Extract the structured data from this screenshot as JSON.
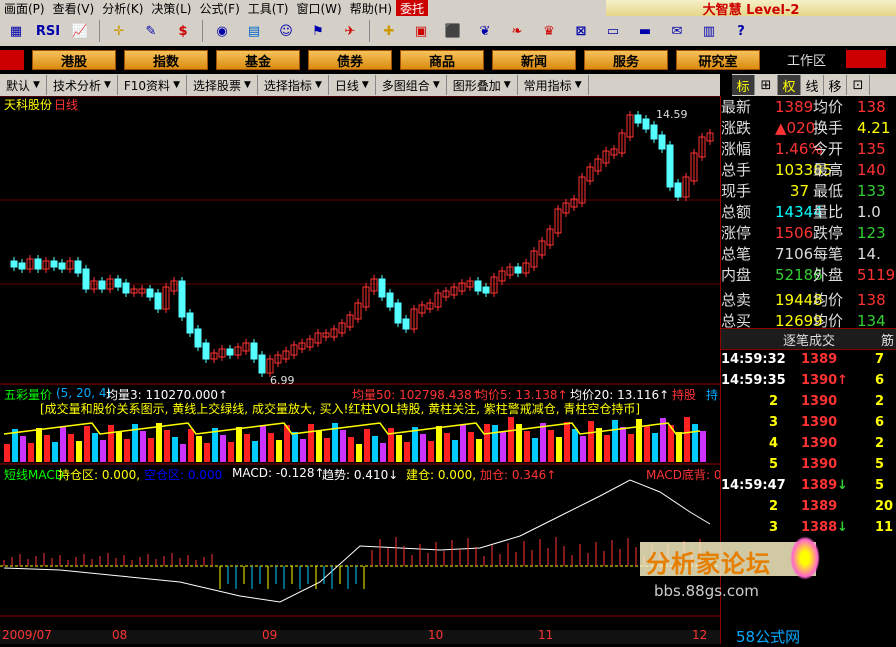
{
  "menu": [
    "画面(P)",
    "查看(V)",
    "分析(K)",
    "决策(L)",
    "公式(F)",
    "工具(T)",
    "窗口(W)",
    "帮助(H)",
    "委托"
  ],
  "brand": "大智慧 Level-2",
  "toolbar_icons": [
    "grid-icon",
    "rsi-icon",
    "chart-icon",
    "crosshair-icon",
    "ruler-icon",
    "dollar-icon",
    "stocks-icon",
    "f10-icon",
    "users-icon",
    "bell-icon",
    "alarm-icon",
    "fund-icon",
    "box-icon",
    "money-icon",
    "link-icon",
    "fire-icon",
    "chess-icon",
    "net-icon",
    "window-icon",
    "window2-icon",
    "mail-icon",
    "document-icon",
    "help-icon"
  ],
  "toolbar_labels": {
    "rsi": "RSI",
    "dollar": "$"
  },
  "nav": {
    "buttons": [
      "港股",
      "指数",
      "基金",
      "债券",
      "商品",
      "新闻",
      "服务",
      "研究室"
    ],
    "workspace": "工作区"
  },
  "tabs": [
    "默认",
    "技术分析",
    "F10资料",
    "选择股票",
    "选择指标",
    "日线",
    "多图组合",
    "图形叠加",
    "常用指标"
  ],
  "rtabs": [
    "标",
    "⊞",
    "权",
    "线",
    "移",
    "⊡"
  ],
  "chart": {
    "stock": "天科股份",
    "period": "日线",
    "high_label": "14.59",
    "low_label": "6.99",
    "vol_title": "五彩量价",
    "vol_params": "(5, 20, 4)",
    "vol_values": "均量3: 110270.000↑",
    "vol_ma50": "均量50: 102798.438↑",
    "vol_ma5p": "均价5: 13.138↑",
    "vol_ma20p": "均价20: 13.116↑",
    "vol_hold": "持股",
    "vol_hold2": "持",
    "vol_note": "[成交量和股价关系图示, 黄线上交绿线, 成交量放大, 买入!红柱VOL持股, 黄柱关注, 紫柱警戒减仓, 青柱空仓持币]",
    "macd_title": "短线MACD",
    "macd_hold": "持仓区: 0.000,",
    "macd_empty": "空仓区: 0.000",
    "macd_val": "MACD: -0.128↑",
    "macd_trend": "趋势: 0.410↓",
    "macd_build": "建仓: 0.000,",
    "macd_add": "加仓: 0.346↑",
    "macd_bottom": "MACD底背: 0.",
    "dates": [
      "2009/07",
      "08",
      "09",
      "10",
      "11",
      "12"
    ]
  },
  "quote": {
    "rows": [
      {
        "k": "最新",
        "v": "1389",
        "vc": "#f33",
        "k2": "均价",
        "v2": "138",
        "v2c": "#f33"
      },
      {
        "k": "涨跌",
        "v": "▲020",
        "vc": "#f33",
        "k2": "换手",
        "v2": "4.21",
        "v2c": "#ff0"
      },
      {
        "k": "涨幅",
        "v": "1.46%",
        "vc": "#f33",
        "k2": "今开",
        "v2": "135",
        "v2c": "#f33"
      },
      {
        "k": "总手",
        "v": "103385",
        "vc": "#ff0",
        "k2": "最高",
        "v2": "140",
        "v2c": "#f33"
      },
      {
        "k": "现手",
        "v": "37",
        "vc": "#ff0",
        "k2": "最低",
        "v2": "133",
        "v2c": "#3c3"
      },
      {
        "k": "总额",
        "v": "14344",
        "vc": "#0ff",
        "k2": "量比",
        "v2": "1.0",
        "v2c": "#ddd"
      },
      {
        "k": "涨停",
        "v": "1506",
        "vc": "#f33",
        "k2": "跌停",
        "v2": "123",
        "v2c": "#3c3"
      },
      {
        "k": "总笔",
        "v": "7106",
        "vc": "#ddd",
        "k2": "每笔",
        "v2": "14.",
        "v2c": "#ddd"
      },
      {
        "k": "内盘",
        "v": "52186",
        "vc": "#3c3",
        "k2": "外盘",
        "v2": "5119",
        "v2c": "#f33"
      },
      {
        "k": "总卖",
        "v": "19448",
        "vc": "#ff0",
        "k2": "均价",
        "v2": "138",
        "v2c": "#f33"
      },
      {
        "k": "总买",
        "v": "12699",
        "vc": "#ff0",
        "k2": "均价",
        "v2": "134",
        "v2c": "#3c3"
      }
    ],
    "tick_header": "逐笔成交",
    "tick_side": "筋",
    "ticks": [
      {
        "t": "14:59:32",
        "p": "1389",
        "a": "",
        "ac": "#f33",
        "v": "7"
      },
      {
        "t": "14:59:35",
        "p": "1390",
        "a": "↑",
        "ac": "#f33",
        "v": "6"
      },
      {
        "t": "2",
        "p": "1390",
        "a": "",
        "ac": "#f33",
        "v": "2"
      },
      {
        "t": "3",
        "p": "1390",
        "a": "",
        "ac": "#f33",
        "v": "6"
      },
      {
        "t": "4",
        "p": "1390",
        "a": "",
        "ac": "#f33",
        "v": "2"
      },
      {
        "t": "5",
        "p": "1390",
        "a": "",
        "ac": "#f33",
        "v": "5"
      },
      {
        "t": "14:59:47",
        "p": "1389",
        "a": "↓",
        "ac": "#3c3",
        "v": "5"
      },
      {
        "t": "2",
        "p": "1389",
        "a": "",
        "ac": "#f33",
        "v": "20"
      },
      {
        "t": "3",
        "p": "1388",
        "a": "↓",
        "ac": "#3c3",
        "v": "11"
      }
    ]
  },
  "watermark": {
    "title": "分析家论坛",
    "url": "bbs.88gs.com",
    "logo": "58公式网"
  }
}
